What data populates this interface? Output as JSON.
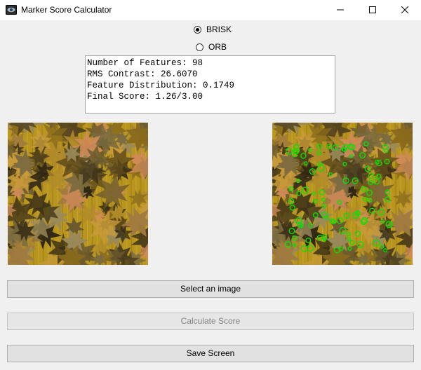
{
  "window": {
    "title": "Marker Score Calculator"
  },
  "detector": {
    "options": [
      "BRISK",
      "ORB"
    ],
    "selected": "BRISK"
  },
  "results": {
    "lines": [
      "Number of Features: 98",
      "RMS Contrast: 26.6070",
      "Feature Distribution: 0.1749",
      "Final Score: 1.26/3.00"
    ]
  },
  "images": {
    "original_icon": "autumn-leaves-image",
    "features_icon": "autumn-leaves-with-green-keypoints-image",
    "keypoint_color": "#00e600"
  },
  "buttons": {
    "select_label": "Select an image",
    "calculate_label": "Calculate Score",
    "save_label": "Save Screen"
  },
  "colors": {
    "window_bg": "#f0f0f0",
    "disabled_text": "#838383"
  }
}
